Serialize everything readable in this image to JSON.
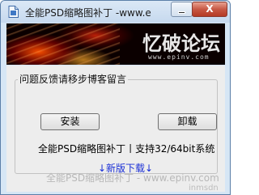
{
  "window": {
    "title": "全能PSD缩略图补丁 -www.e",
    "close_glyph": "X",
    "minimize_icon": "minimize-icon",
    "close_icon": "close-icon",
    "app_icon": "document-icon"
  },
  "banner": {
    "logo_text": "忆破论坛",
    "url_text": "www.epinv.com"
  },
  "group": {
    "legend": "问题反馈请移步博客留言"
  },
  "buttons": {
    "install_label": "安装",
    "uninstall_label": "卸载"
  },
  "info": {
    "version_text": "全能PSD缩略图补丁丨支持32/64bit系统",
    "download_link": "↓新版下载↓"
  },
  "footer": {
    "watermark": "全能PSD缩略图补丁 - www.epinv.com",
    "corner_mark": "inmsdn"
  },
  "colors": {
    "accent_link": "#1a2fd6",
    "close_red": "#c75844",
    "title_bar": "#c6d9ee"
  }
}
